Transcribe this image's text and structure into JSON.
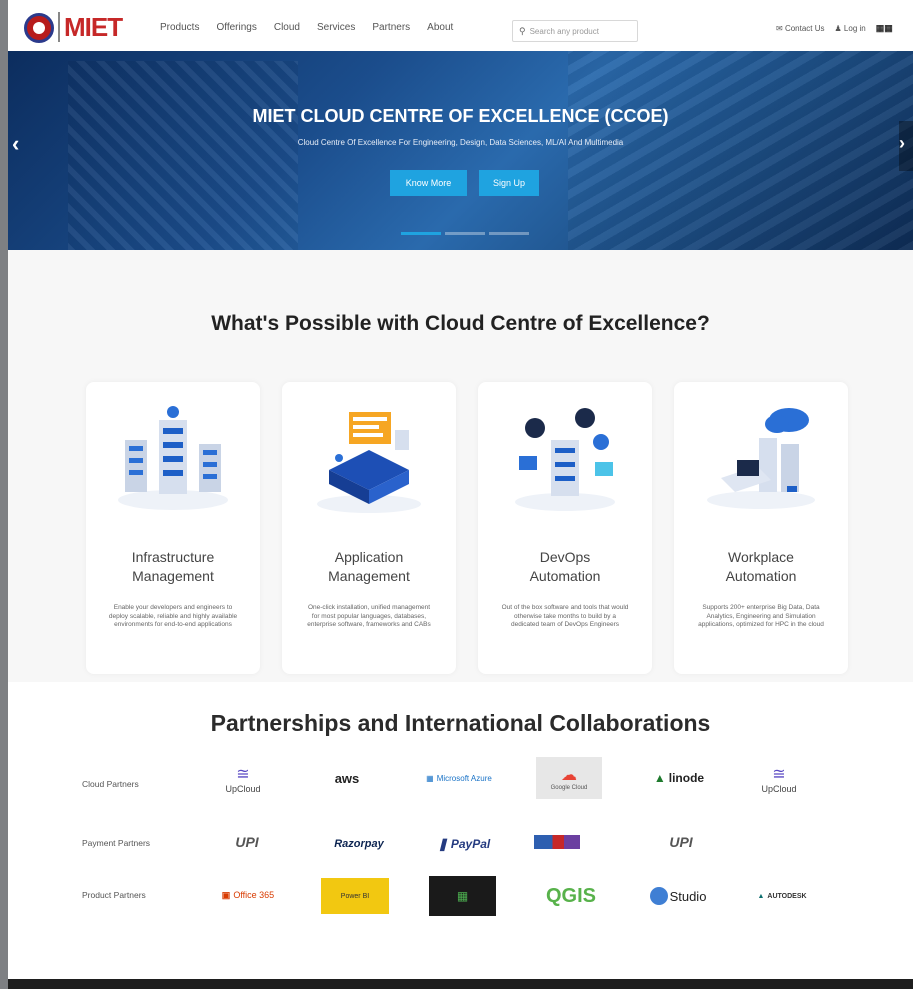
{
  "nav": {
    "logo_text_prefix": "",
    "logo_text": "MIET",
    "menu": [
      "Products",
      "Offerings",
      "Cloud",
      "Services",
      "Partners",
      "About"
    ],
    "search_placeholder": "Search any product",
    "contact": "Contact Us",
    "login": "Log in",
    "grid_icon": "grid-icon"
  },
  "hero": {
    "title": "MIET CLOUD CENTRE OF EXCELLENCE (CCOE)",
    "subtitle": "Cloud Centre Of Excellence For Engineering, Design, Data Sciences, ML/AI And Multimedia",
    "btn_know": "Know More",
    "btn_signup": "Sign Up",
    "accent": "#1fa3e0"
  },
  "possible": {
    "heading": "What's Possible with Cloud Centre of Excellence?",
    "cards": [
      {
        "title_1": "Infrastructure",
        "title_2": "Management",
        "desc": "Enable your developers and engineers to deploy scalable, reliable and highly available environments for end-to-end applications"
      },
      {
        "title_1": "Application",
        "title_2": "Management",
        "desc": "One-click installation, unified management for most popular languages, databases, enterprise software, frameworks and CABs"
      },
      {
        "title_1": "DevOps",
        "title_2": "Automation",
        "desc": "Out of the box software and tools that would otherwise take months to build by a dedicated team of DevOps Engineers"
      },
      {
        "title_1": "Workplace",
        "title_2": "Automation",
        "desc": "Supports 200+ enterprise Big Data, Data Analytics, Engineering and Simulation applications, optimized for HPC in the cloud"
      }
    ]
  },
  "partners": {
    "heading": "Partnerships and International Collaborations",
    "cloud_label": "Cloud Partners",
    "payment_label": "Payment Partners",
    "product_label": "Product Partners",
    "cloud": [
      "UpCloud",
      "aws",
      "Microsoft Azure",
      "Google Cloud",
      "linode",
      "UpCloud"
    ],
    "payment": [
      "UPI",
      "Razorpay",
      "PayPal",
      "",
      "UPI"
    ],
    "product": [
      "Office 365",
      "Power BI",
      "",
      "QGIS",
      "Studio",
      "AUTODESK"
    ]
  }
}
